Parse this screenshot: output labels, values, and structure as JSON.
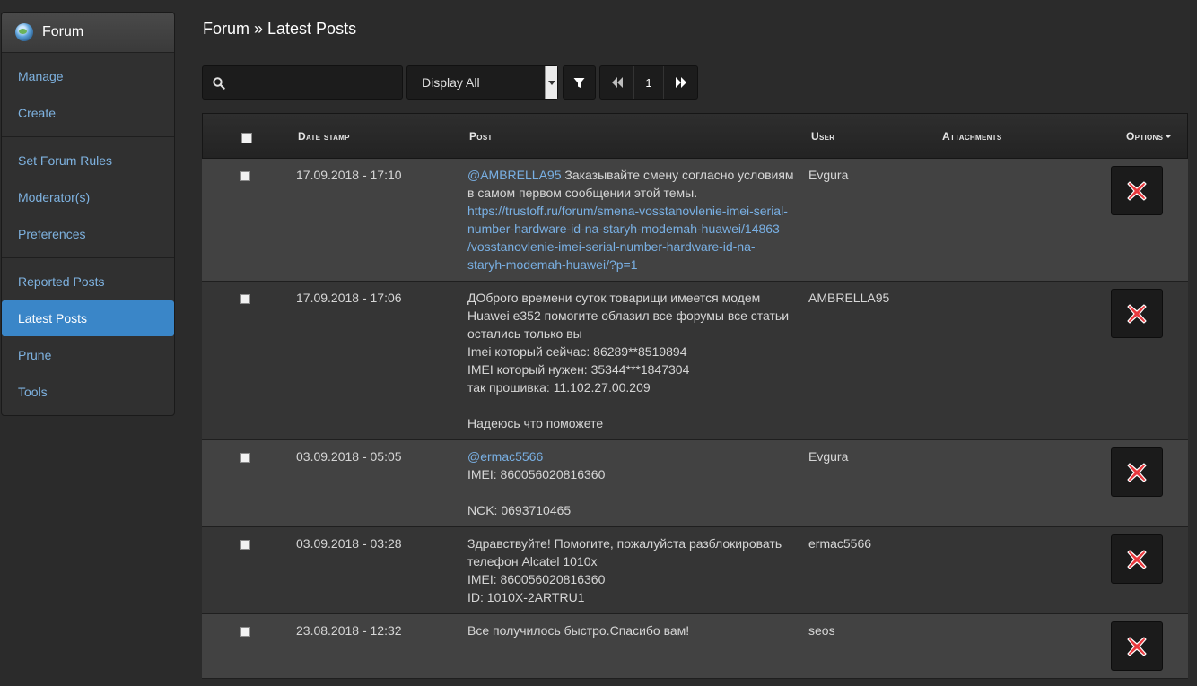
{
  "sidebar": {
    "title": "Forum",
    "groups": [
      [
        {
          "label": "Manage"
        },
        {
          "label": "Create"
        }
      ],
      [
        {
          "label": "Set Forum Rules"
        },
        {
          "label": "Moderator(s)"
        },
        {
          "label": "Preferences"
        }
      ],
      [
        {
          "label": "Reported Posts"
        },
        {
          "label": "Latest Posts",
          "active": true
        },
        {
          "label": "Prune"
        },
        {
          "label": "Tools"
        }
      ]
    ]
  },
  "page": {
    "title": "Forum » Latest Posts"
  },
  "toolbar": {
    "search_value": "",
    "display_select": "Display All",
    "page_number": "1"
  },
  "table": {
    "headers": {
      "date": "Date stamp",
      "post": "Post",
      "user": "User",
      "attachments": "Attachments",
      "options": "Options"
    },
    "rows": [
      {
        "date": "17.09.2018 - 17:10",
        "post": [
          [
            {
              "t": "@AMBRELLA95",
              "link": true
            },
            {
              "t": " Заказывайте смену согласно условиям"
            }
          ],
          [
            {
              "t": "в самом первом сообщении этой темы."
            }
          ],
          [
            {
              "t": "https://trustoff.ru/forum/smena-vosstanovlenie-imei-serial-",
              "link": true
            }
          ],
          [
            {
              "t": "number-hardware-id-na-staryh-modemah-huawei/14863",
              "link": true
            }
          ],
          [
            {
              "t": "/vosstanovlenie-imei-serial-number-hardware-id-na-",
              "link": true
            }
          ],
          [
            {
              "t": "staryh-modemah-huawei/?p=1",
              "link": true
            }
          ]
        ],
        "user": "Evgura",
        "height": 137
      },
      {
        "date": "17.09.2018 - 17:06",
        "post": [
          [
            {
              "t": "ДОброго времени суток товарищи имеется модем"
            }
          ],
          [
            {
              "t": "Huawei e352 помогите облазил все форумы все статьи"
            }
          ],
          [
            {
              "t": "остались только вы"
            }
          ],
          [
            {
              "t": "Imei который сейчас: 86289**8519894"
            }
          ],
          [
            {
              "t": "IMEI который нужен: 35344***1847304"
            }
          ],
          [
            {
              "t": "так прошивка: 11.102.27.00.209"
            }
          ],
          [
            {
              "t": ""
            }
          ],
          [
            {
              "t": "Надеюсь что поможете"
            }
          ]
        ],
        "user": "AMBRELLA95",
        "height": 177
      },
      {
        "date": "03.09.2018 - 05:05",
        "post": [
          [
            {
              "t": "@ermac5566",
              "link": true
            }
          ],
          [
            {
              "t": "IMEI: 860056020816360"
            }
          ],
          [
            {
              "t": ""
            }
          ],
          [
            {
              "t": "NCK: 0693710465"
            }
          ]
        ],
        "user": "Evgura",
        "height": 97
      },
      {
        "date": "03.09.2018 - 03:28",
        "post": [
          [
            {
              "t": "Здравствуйте! Помогите, пожалуйста разблокировать"
            }
          ],
          [
            {
              "t": "телефон Alcatel 1010x"
            }
          ],
          [
            {
              "t": "IMEI: 860056020816360"
            }
          ],
          [
            {
              "t": "ID: 1010X-2ARTRU1"
            }
          ]
        ],
        "user": "ermac5566",
        "height": 97
      },
      {
        "date": "23.08.2018 - 12:32",
        "post": [
          [
            {
              "t": "Все получилось быстро.Спасибо вам!"
            }
          ]
        ],
        "user": "seos",
        "height": 72
      }
    ]
  },
  "colors": {
    "accent": "#3a86c8",
    "link": "#79b0e4",
    "delete_icon": "#e8383d"
  }
}
